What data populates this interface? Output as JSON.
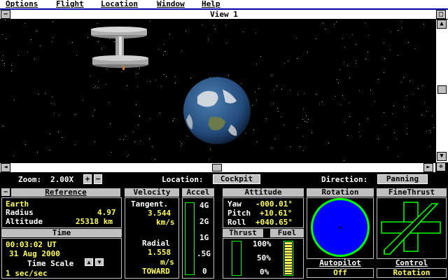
{
  "menubar": {
    "items": [
      {
        "label": "Options"
      },
      {
        "label": "Flight"
      },
      {
        "label": "Location"
      },
      {
        "label": "Window"
      },
      {
        "label": "Help"
      }
    ]
  },
  "view": {
    "title": "View 1",
    "minimize_glyph": "−",
    "maximize_glyph": "□"
  },
  "status": {
    "zoom_label": "Zoom:",
    "zoom_value": "2.00X",
    "zoom_in": "+",
    "zoom_out": "−",
    "location_label": "Location:",
    "location_value": "Cockpit",
    "direction_label": "Direction:",
    "direction_value": "Panning"
  },
  "reference": {
    "title": "Reference",
    "body": "Earth",
    "radius_label": "Radius",
    "radius_value": "4.97",
    "altitude_label": "Altitude",
    "altitude_value": "25318 km"
  },
  "time": {
    "title": "Time",
    "clock": "00:03:02 UT",
    "date": "31 Aug 2000",
    "scale_label": "Time Scale",
    "rate": "1 sec/sec"
  },
  "velocity": {
    "title": "Velocity",
    "tangent_label": "Tangent.",
    "tangent_value": "3.544",
    "tangent_unit": "km/s",
    "radial_label": "Radial",
    "radial_value": "1.558",
    "radial_unit": "m/s",
    "radial_dir": "TOWARD"
  },
  "accel": {
    "title": "Accel",
    "ticks": [
      "4G",
      "2G",
      "1G",
      ".5G",
      "0"
    ]
  },
  "attitude": {
    "title": "Attitude",
    "yaw_label": "Yaw",
    "yaw_value": "-000.01°",
    "pitch_label": "Pitch",
    "pitch_value": "+10.61°",
    "roll_label": "Roll",
    "roll_value": "+040.65°"
  },
  "thrust": {
    "title": "Thrust",
    "fuel_title": "Fuel",
    "ticks": [
      "100%",
      "50%",
      "0%"
    ],
    "fuel_level": 1.0
  },
  "rotation": {
    "title": "Rotation"
  },
  "finethrust": {
    "title": "FineThrust"
  },
  "autopilot": {
    "title": "Autopilot",
    "value": "Off"
  },
  "control": {
    "title": "Control",
    "value": "Rotation"
  },
  "colors": {
    "desktop": "#0000a8",
    "readout_yellow": "#ffff55",
    "gauge_green": "#00ff00",
    "rotation_fill": "#0000ff"
  }
}
